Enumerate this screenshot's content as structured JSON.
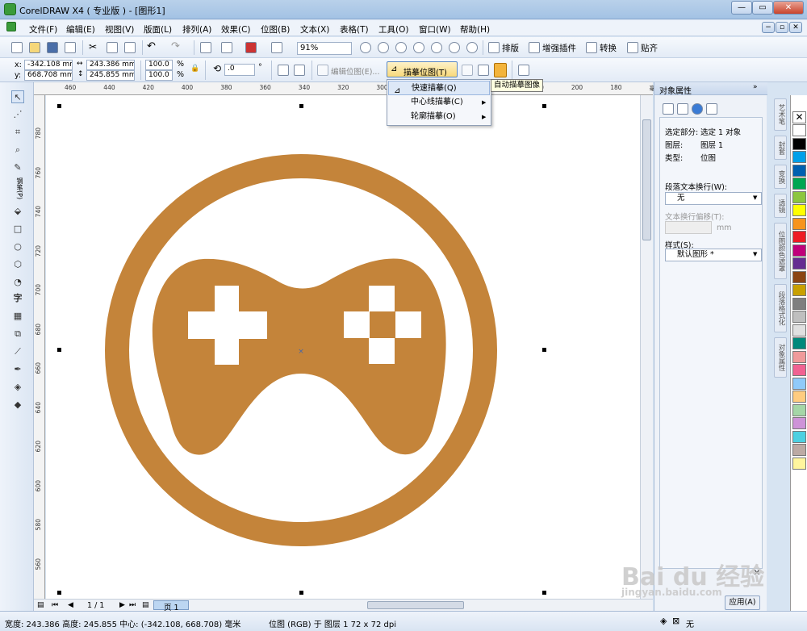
{
  "window": {
    "title": "CorelDRAW X4 ( 专业版 ) - [图形1]",
    "min": "—",
    "restore": "▭",
    "close": "✕",
    "sub_min": "−",
    "sub_restore": "▫",
    "sub_close": "✕"
  },
  "menu": [
    "文件(F)",
    "编辑(E)",
    "视图(V)",
    "版面(L)",
    "排列(A)",
    "效果(C)",
    "位图(B)",
    "文本(X)",
    "表格(T)",
    "工具(O)",
    "窗口(W)",
    "帮助(H)"
  ],
  "toolbar1": {
    "zoom": "91%",
    "buttons": [
      "排版",
      "增强插件",
      "转换",
      "贴齐"
    ]
  },
  "propbar": {
    "x_label": "x:",
    "x_value": "-342.108 mm",
    "y_label": "y:",
    "y_value": "668.708 mm",
    "w_value": "243.386 mm",
    "h_value": "245.855 mm",
    "scale_x": "100.0",
    "scale_y": "100.0",
    "pct": "%",
    "angle": ".0",
    "deg": "°",
    "edit_bitmap": "编辑位图(E)...",
    "trace_bitmap": "描摹位图(T)"
  },
  "trace_menu": {
    "items": [
      "快速描摹(Q)",
      "中心线描摹(C)",
      "轮廓描摹(O)"
    ],
    "tooltip": "自动描摹图像"
  },
  "ruler_top": [
    "460",
    "440",
    "420",
    "400",
    "380",
    "360",
    "340",
    "320",
    "300",
    "280",
    "260",
    "240",
    "220",
    "200",
    "180",
    "毫米"
  ],
  "ruler_left": [
    "780",
    "760",
    "740",
    "720",
    "700",
    "680",
    "660",
    "640",
    "620",
    "600",
    "580",
    "560"
  ],
  "toolbox": {
    "left_label": "钢笔(P)"
  },
  "docker": {
    "title": "对象属性",
    "selection_label": "选定部分:",
    "selection_value": "选定 1 对象",
    "layer_label": "图层:",
    "layer_value": "图层 1",
    "type_label": "类型:",
    "type_value": "位图",
    "wrap_label": "段落文本换行(W):",
    "wrap_value": "无",
    "offset_label": "文本换行偏移(T):",
    "offset_unit": "mm",
    "style_label": "样式(S):",
    "style_value": "默认图形 *",
    "apply": "应用(A)"
  },
  "docker_tabs": [
    "艺术笔",
    "封套",
    "变换",
    "透镜",
    "位图颜色遮罩",
    "段落格式化",
    "对象属性"
  ],
  "pages": {
    "counter": "1 / 1",
    "page_tab": "页 1"
  },
  "status": {
    "left": "宽度: 243.386 高度: 245.855 中心: (-342.108, 668.708) 毫米",
    "mid": "位图 (RGB) 于 图层 1 72 x 72 dpi",
    "fill": "无"
  },
  "watermark": {
    "brand": "Bai du 经验",
    "url": "jingyan.baidu.com"
  },
  "colors": {
    "icon": "#c4843a",
    "palette": [
      "#ffffff",
      "#000000",
      "#00a0e9",
      "#0060b0",
      "#00a651",
      "#8dc63f",
      "#ffff00",
      "#f7941d",
      "#ed1c24",
      "#c0007a",
      "#662d91",
      "#8b4513",
      "#c8a000",
      "#7f7f7f",
      "#bfbfbf",
      "#e0e0e0",
      "#00897b",
      "#ef9a9a",
      "#f06292",
      "#90caf9",
      "#ffcc80",
      "#a5d6a7",
      "#ce93d8",
      "#4dd0e1",
      "#bcaaa4",
      "#fff59d"
    ]
  }
}
